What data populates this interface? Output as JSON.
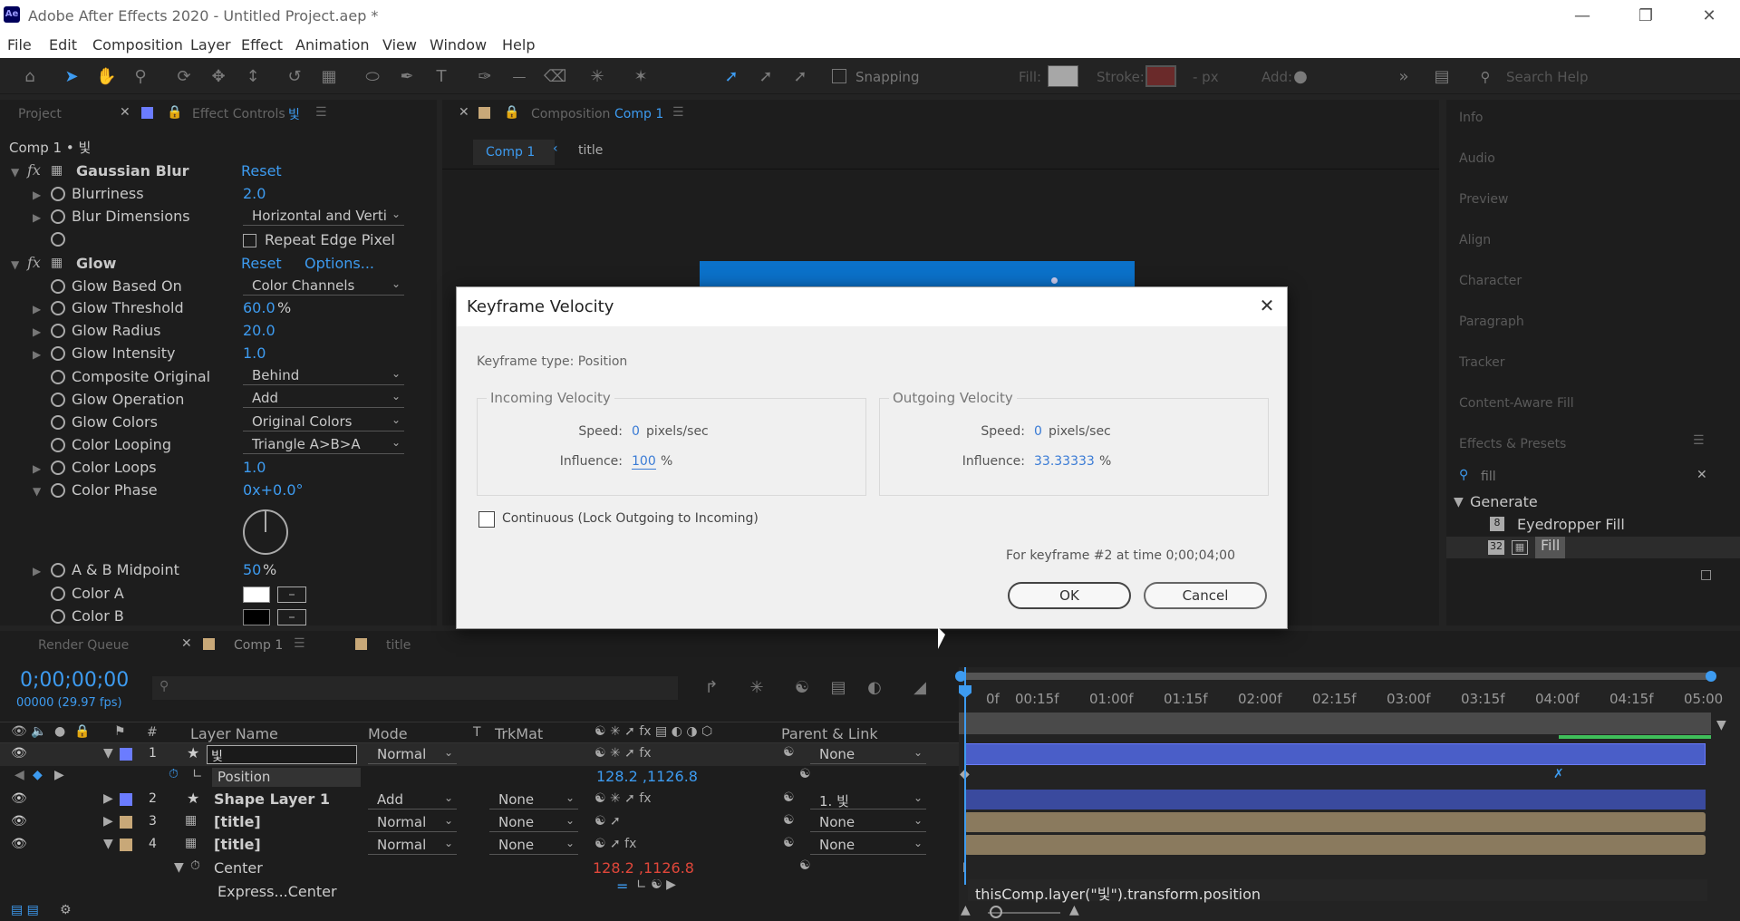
{
  "window": {
    "title": "Adobe After Effects 2020 - Untitled Project.aep *",
    "logo": "Ae"
  },
  "menu": [
    "File",
    "Edit",
    "Composition",
    "Layer",
    "Effect",
    "Animation",
    "View",
    "Window",
    "Help"
  ],
  "toolbar": {
    "snapping": "Snapping",
    "fill": "Fill:",
    "stroke": "Stroke:",
    "px": "- px",
    "add": "Add:",
    "search_placeholder": "Search Help"
  },
  "left_panel": {
    "tab_project": "Project",
    "tab_effect": "Effect Controls",
    "tab_effect_layer": "빛",
    "header": "Comp 1 • 빛",
    "effects": [
      {
        "name": "Gaussian Blur",
        "reset": "Reset"
      },
      {
        "name": "Glow",
        "reset": "Reset",
        "options": "Options..."
      }
    ],
    "props": {
      "blurriness_label": "Blurriness",
      "blurriness_value": "2.0",
      "blur_dim_label": "Blur Dimensions",
      "blur_dim_value": "Horizontal and Verti",
      "repeat_edge": "Repeat Edge Pixel",
      "glow_based_label": "Glow Based On",
      "glow_based_value": "Color Channels",
      "glow_threshold_label": "Glow Threshold",
      "glow_threshold_value": "60.0",
      "glow_threshold_unit": "%",
      "glow_radius_label": "Glow Radius",
      "glow_radius_value": "20.0",
      "glow_intensity_label": "Glow Intensity",
      "glow_intensity_value": "1.0",
      "composite_label": "Composite Original",
      "composite_value": "Behind",
      "glow_op_label": "Glow Operation",
      "glow_op_value": "Add",
      "glow_colors_label": "Glow Colors",
      "glow_colors_value": "Original Colors",
      "color_looping_label": "Color Looping",
      "color_looping_value": "Triangle A>B>A",
      "color_loops_label": "Color Loops",
      "color_loops_value": "1.0",
      "color_phase_label": "Color Phase",
      "color_phase_value": "0x+0.0°",
      "ab_mid_label": "A & B Midpoint",
      "ab_mid_value": "50",
      "ab_mid_unit": "%",
      "color_a_label": "Color A",
      "color_b_label": "Color B"
    }
  },
  "comp_panel": {
    "tab_label": "Composition",
    "tab_name": "Comp 1",
    "crumb_1": "Comp 1",
    "crumb_2": "title"
  },
  "right_panels": [
    "Info",
    "Audio",
    "Preview",
    "Align",
    "Character",
    "Paragraph",
    "Tracker",
    "Content-Aware Fill",
    "Effects & Presets"
  ],
  "effects_presets": {
    "search_value": "fill",
    "group": "Generate",
    "items": [
      {
        "badge": "8",
        "label": "Eyedropper Fill"
      },
      {
        "badge": "32",
        "label": "Fill"
      }
    ]
  },
  "dialog": {
    "title": "Keyframe Velocity",
    "keyframe_type": "Keyframe type: Position",
    "incoming": {
      "legend": "Incoming Velocity",
      "speed_label": "Speed:",
      "speed_value": "0",
      "speed_unit": "pixels/sec",
      "influence_label": "Influence:",
      "influence_value": "100",
      "influence_unit": "%"
    },
    "outgoing": {
      "legend": "Outgoing Velocity",
      "speed_label": "Speed:",
      "speed_value": "0",
      "speed_unit": "pixels/sec",
      "influence_label": "Influence:",
      "influence_value": "33.33333",
      "influence_unit": "%"
    },
    "continuous": "Continuous (Lock Outgoing to Incoming)",
    "info": "For keyframe #2 at time 0;00;04;00",
    "ok": "OK",
    "cancel": "Cancel"
  },
  "timeline": {
    "tab_render": "Render Queue",
    "tab_comp": "Comp 1",
    "tab_title": "title",
    "timecode": "0;00;00;00",
    "fps": "00000 (29.97 fps)",
    "col_hash": "#",
    "col_layer": "Layer Name",
    "col_mode": "Mode",
    "col_t": "T",
    "col_trkmat": "TrkMat",
    "col_parent": "Parent & Link",
    "ruler": [
      "0f",
      "00:15f",
      "01:00f",
      "01:15f",
      "02:00f",
      "02:15f",
      "03:00f",
      "03:15f",
      "04:00f",
      "04:15f",
      "05:00"
    ],
    "layers": [
      {
        "num": "1",
        "name": "빛",
        "mode": "Normal",
        "trkmat": "",
        "parent": "None"
      },
      {
        "num": "2",
        "name": "Shape Layer 1",
        "mode": "Add",
        "trkmat": "None",
        "parent": "1. 빛"
      },
      {
        "num": "3",
        "name": "[title]",
        "mode": "Normal",
        "trkmat": "None",
        "parent": "None"
      },
      {
        "num": "4",
        "name": "[title]",
        "mode": "Normal",
        "trkmat": "None",
        "parent": "None"
      }
    ],
    "position_label": "Position",
    "position_value": "128.2 ,1126.8",
    "center_label": "Center",
    "center_value": "128.2 ,1126.8",
    "express_label": "Express...Center",
    "expression": "thisComp.layer(\"빛\").transform.position"
  },
  "colors": {
    "accent": "#3d9bf0",
    "layer_blue": "#4a5ec8",
    "layer_tan": "#a08c6a",
    "red_value": "#e0473a"
  }
}
